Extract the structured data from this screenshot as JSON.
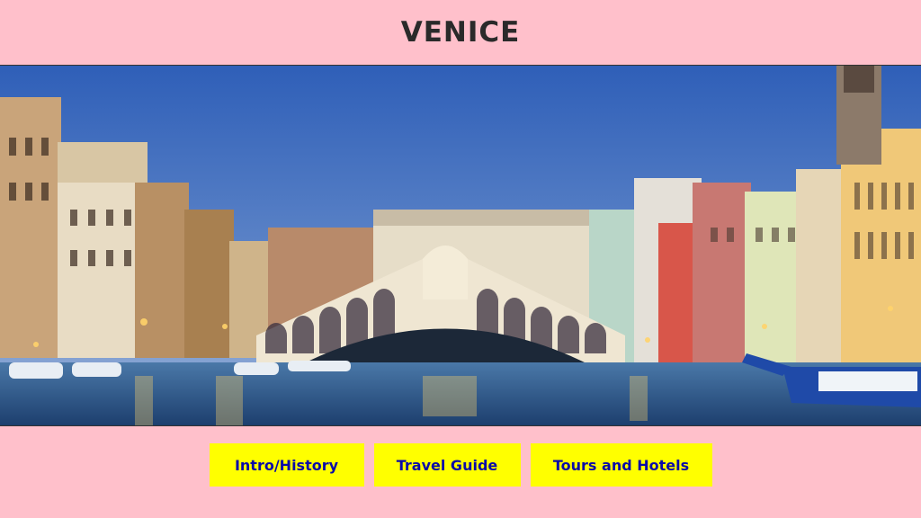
{
  "page": {
    "title": "VENICE"
  },
  "hero": {
    "image_subject": "Rialto Bridge over the Grand Canal at dusk"
  },
  "nav": {
    "items": [
      {
        "label": "Intro/History"
      },
      {
        "label": "Travel Guide"
      },
      {
        "label": "Tours and Hotels"
      }
    ]
  },
  "colors": {
    "background": "#ffc0cb",
    "button_bg": "#ffff00",
    "button_text": "#0a0aa8",
    "title_text": "#2a2a2a"
  }
}
